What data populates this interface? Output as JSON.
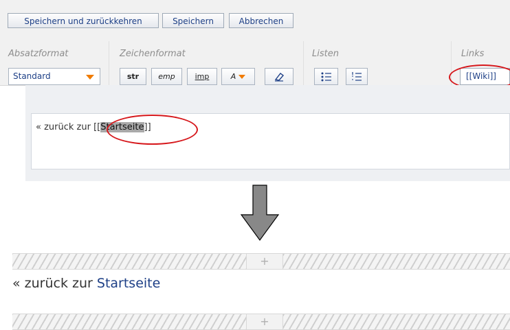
{
  "buttons": {
    "save_return": "Speichern und zurückkehren",
    "save": "Speichern",
    "cancel": "Abbrechen"
  },
  "groups": {
    "paragraph": "Absatzformat",
    "character": "Zeichenformat",
    "lists": "Listen",
    "links": "Links"
  },
  "paragraph_select": {
    "value": "Standard"
  },
  "char_buttons": {
    "strong": "str",
    "emphasis": "emp",
    "important": "imp",
    "color": "A"
  },
  "links": {
    "wiki": "[[Wiki]]"
  },
  "editor": {
    "prefix": "« zurück zur ",
    "open": "[[",
    "selected": "Startseite",
    "close": "]]"
  },
  "result": {
    "prefix": "« zurück zur ",
    "link": "Startseite"
  },
  "hatch": {
    "plus": "+"
  },
  "colors": {
    "accent_orange": "#f07b00",
    "link_blue": "#1d3f86",
    "annotation_red": "#d6171b"
  }
}
